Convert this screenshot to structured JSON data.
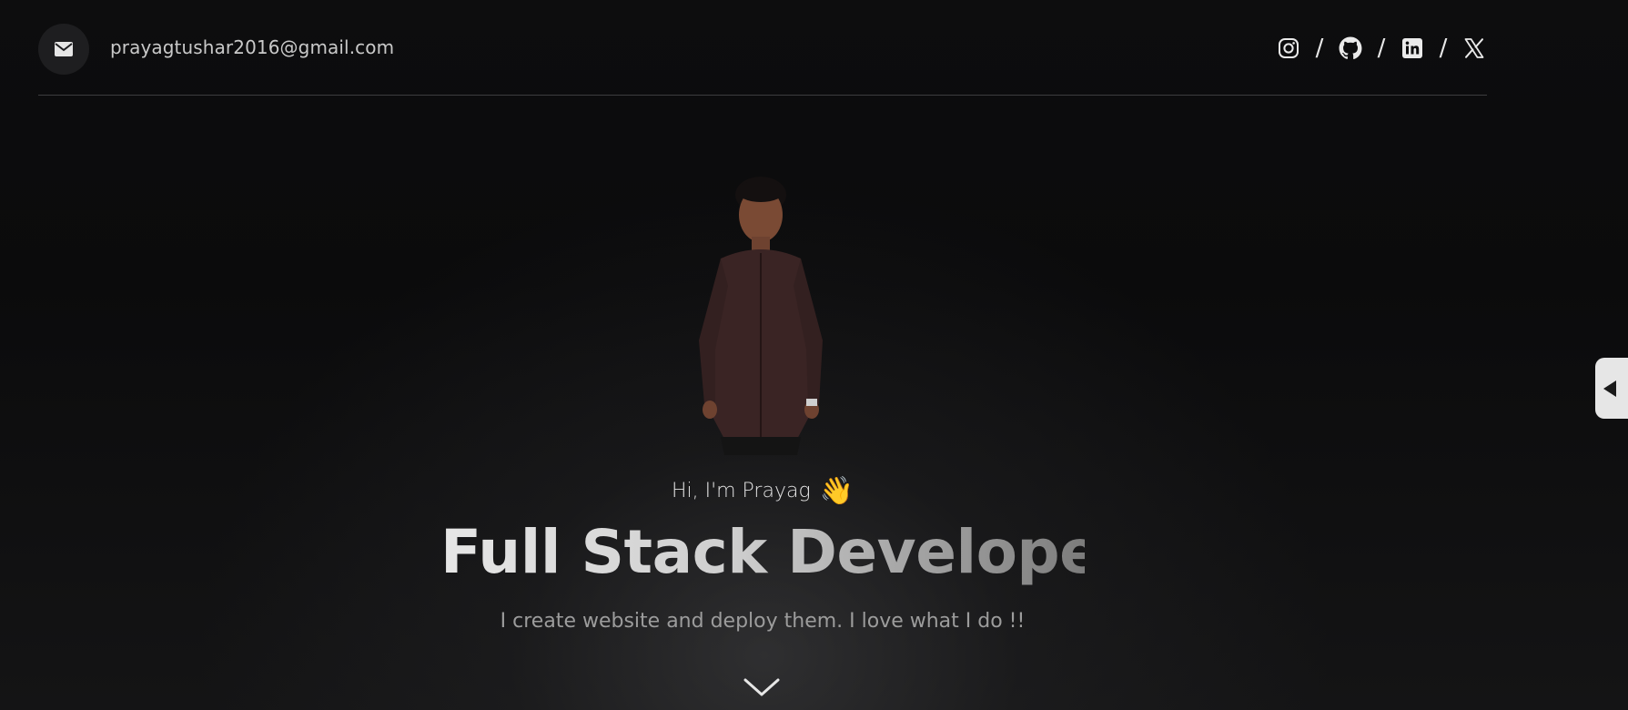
{
  "header": {
    "email": "prayagtushar2016@gmail.com",
    "icons": {
      "mail": "mail-icon",
      "instagram": "instagram-icon",
      "github": "github-icon",
      "linkedin": "linkedin-icon",
      "x": "x-twitter-icon"
    },
    "separator": "/"
  },
  "hero": {
    "greeting": "Hi, I'm Prayag",
    "wave_emoji": "👋",
    "headline": "Full Stack Developer",
    "subtitle": "I create website and deploy them. I love what I do !!"
  },
  "colors": {
    "background": "#0c0c0d",
    "text": "#d9d9d9",
    "muted": "#9c9c9c",
    "toggle": "#e6e6e6"
  }
}
